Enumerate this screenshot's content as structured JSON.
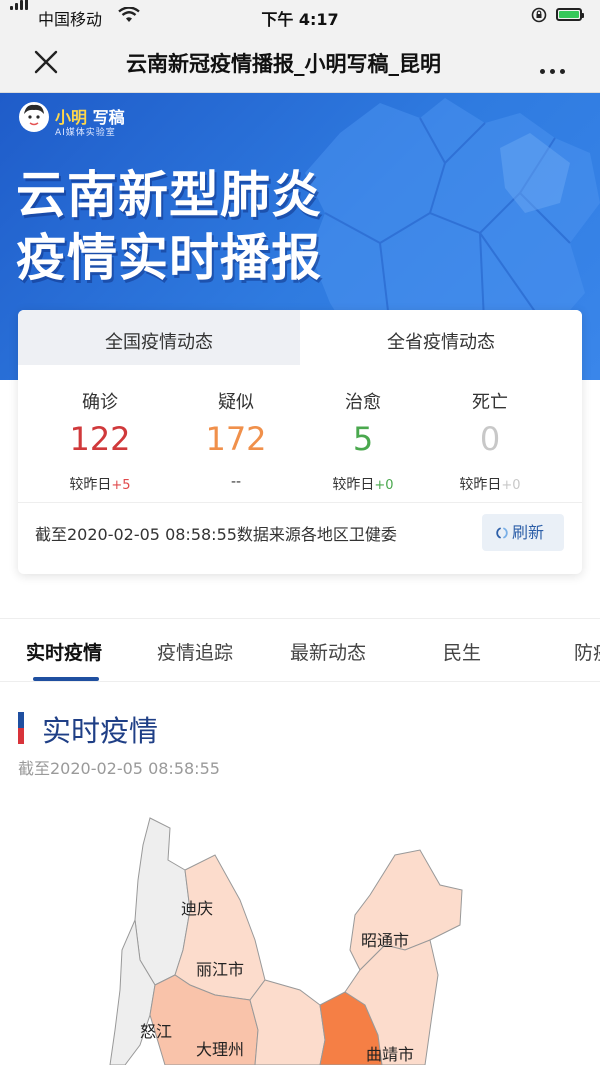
{
  "status_bar": {
    "carrier": "中国移动",
    "time": "下午 4:17"
  },
  "nav": {
    "title": "云南新冠疫情播报_小明写稿_昆明"
  },
  "banner": {
    "logo_name_highlight": "小明",
    "logo_name_rest": " 写稿",
    "logo_sub": "AI媒体实验室",
    "headline_line1": "云南新型肺炎",
    "headline_line2": "疫情实时播报"
  },
  "stats_card": {
    "tabs": [
      {
        "label": "全国疫情动态",
        "active": false
      },
      {
        "label": "全省疫情动态",
        "active": true
      }
    ],
    "stats": [
      {
        "label": "确诊",
        "value": "122",
        "diff_prefix": "较昨日",
        "diff": "+5",
        "color": "#d0393b",
        "diff_color": "#e0494b"
      },
      {
        "label": "疑似",
        "value": "172",
        "diff_prefix": "--",
        "diff": "",
        "color": "#f0904b",
        "diff_color": "#f0904b"
      },
      {
        "label": "治愈",
        "value": "5",
        "diff_prefix": "较昨日",
        "diff": "+0",
        "color": "#4aa84e",
        "diff_color": "#4aa84e"
      },
      {
        "label": "死亡",
        "value": "0",
        "diff_prefix": "较昨日",
        "diff": "+0",
        "color": "#c8c8c8",
        "diff_color": "#c8c8c8"
      }
    ],
    "note": "截至2020-02-05 08:58:55数据来源各地区卫健委",
    "refresh_label": "刷新"
  },
  "content_tabs": {
    "items": [
      "实时疫情",
      "疫情追踪",
      "最新动态",
      "民生",
      "防疫"
    ],
    "active_index": 0
  },
  "section": {
    "title": "实时疫情",
    "timestamp": "截至2020-02-05 08:58:55"
  },
  "map_labels": [
    "迪庆",
    "丽江市",
    "昭通市",
    "怒江",
    "大理州",
    "曲靖市"
  ],
  "colors": {
    "brand_blue": "#1f4fa0",
    "banner_blue": "#2f7be0",
    "map_high": "#f57f45",
    "map_mid": "#f9c3aa",
    "map_low": "#fcdccc",
    "map_none": "#eeeeee"
  }
}
